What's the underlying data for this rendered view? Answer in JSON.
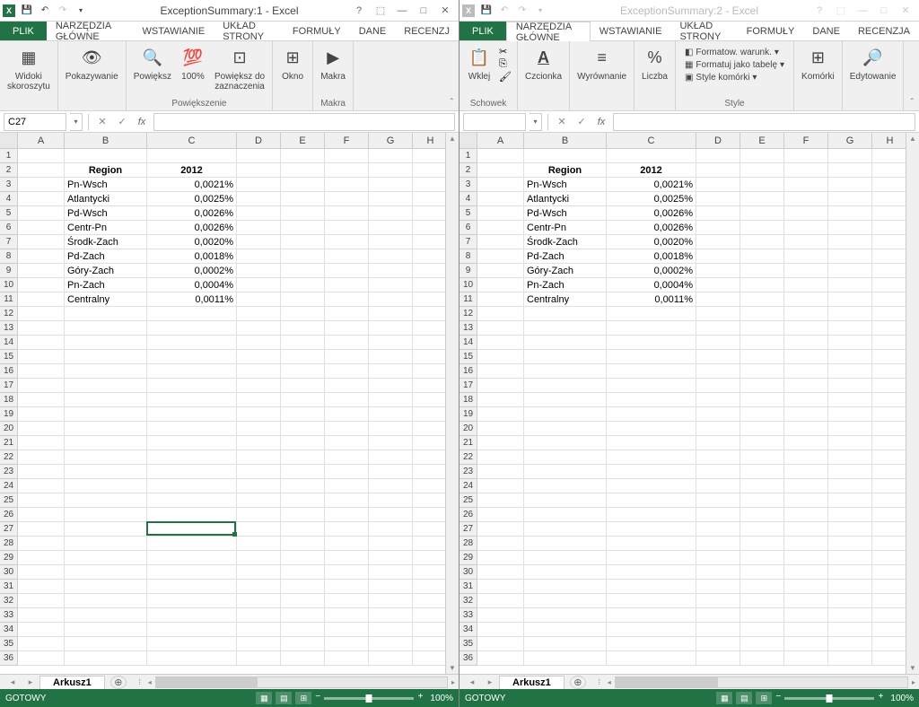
{
  "window1": {
    "title": "ExceptionSummary:1 - Excel",
    "activeCell": "C27",
    "sheet": "Arkusz1",
    "status": "GOTOWY",
    "zoom": "100%"
  },
  "window2": {
    "title": "ExceptionSummary:2 - Excel",
    "activeCell": "",
    "sheet": "Arkusz1",
    "status": "GOTOWY",
    "zoom": "100%"
  },
  "tabs": {
    "plik": "PLIK",
    "glowne": "NARZĘDZIA GŁÓWNE",
    "wstawianie": "WSTAWIANIE",
    "uklad": "UKŁAD STRONY",
    "formuly": "FORMUŁY",
    "dane": "DANE",
    "recenzja1": "RECENZJ",
    "recenzja2": "RECENZJA"
  },
  "ribbon1": {
    "widoki": "Widoki\nskoroszytu",
    "pokazywanie": "Pokazywanie",
    "powieksz": "Powiększ",
    "sto": "100%",
    "powieksz_zazn": "Powiększ do\nzaznaczenia",
    "powiekszenie": "Powiększenie",
    "okno": "Okno",
    "makra": "Makra",
    "makra_grp": "Makra"
  },
  "ribbon2": {
    "wklej": "Wklej",
    "schowek": "Schowek",
    "czcionka": "Czcionka",
    "wyrownanie": "Wyrównanie",
    "liczba": "Liczba",
    "formatow": "Formatow. warunk.",
    "formatuj_tab": "Formatuj jako tabelę",
    "style_kom": "Style komórki",
    "style": "Style",
    "komorki": "Komórki",
    "edytowanie": "Edytowanie"
  },
  "columns": [
    "A",
    "B",
    "C",
    "D",
    "E",
    "F",
    "G",
    "H"
  ],
  "data": {
    "header": {
      "b": "Region",
      "c": "2012"
    },
    "rows": [
      {
        "b": "Pn-Wsch",
        "c": "0,0021%"
      },
      {
        "b": "Atlantycki",
        "c": "0,0025%"
      },
      {
        "b": "Pd-Wsch",
        "c": "0,0026%"
      },
      {
        "b": "Centr-Pn",
        "c": "0,0026%"
      },
      {
        "b": "Środk-Zach",
        "c": "0,0020%"
      },
      {
        "b": "Pd-Zach",
        "c": "0,0018%"
      },
      {
        "b": "Góry-Zach",
        "c": "0,0002%"
      },
      {
        "b": "Pn-Zach",
        "c": "0,0004%"
      },
      {
        "b": "Centralny",
        "c": "0,0011%"
      }
    ]
  }
}
